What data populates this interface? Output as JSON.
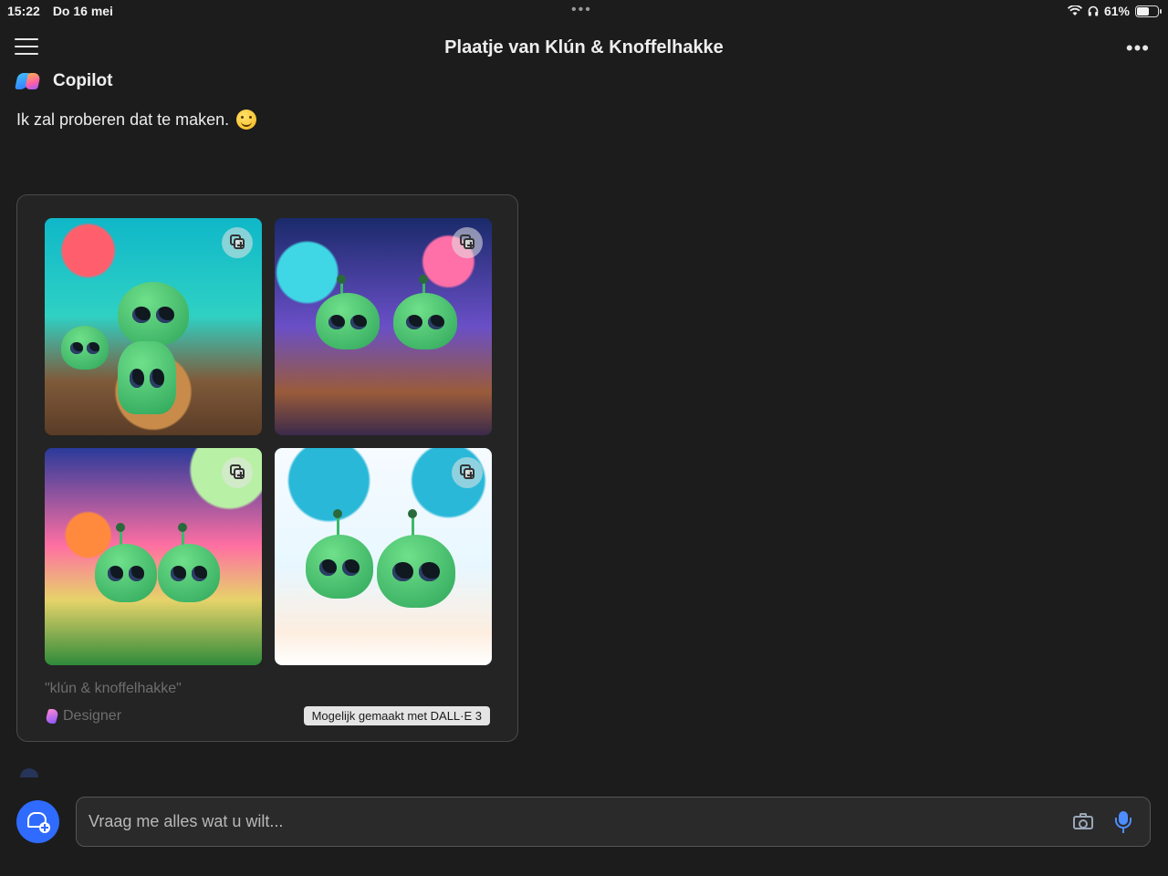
{
  "status_bar": {
    "time": "15:22",
    "date": "Do 16 mei",
    "multitask_indicator": "•••",
    "battery_percent": "61%",
    "battery_level": 0.61
  },
  "header": {
    "title": "Plaatje van Klún & Knoffelhakke",
    "more_label": "•••"
  },
  "message": {
    "sender": "Copilot",
    "text": "Ik zal proberen dat te maken.",
    "emoji_icon": "smiling-face-icon"
  },
  "image_card": {
    "prompt": "\"klún & knoffelhakke\"",
    "source_label": "Designer",
    "dalle_badge": "Mogelijk gemaakt met DALL·E 3",
    "images": [
      {
        "description_icon": "alien-image-1"
      },
      {
        "description_icon": "alien-image-2"
      },
      {
        "description_icon": "alien-image-3"
      },
      {
        "description_icon": "alien-image-4"
      }
    ]
  },
  "composer": {
    "placeholder": "Vraag me alles wat u wilt...",
    "value": ""
  },
  "colors": {
    "background": "#1c1c1c",
    "accent": "#2f6bff",
    "mic": "#4e8dff"
  }
}
